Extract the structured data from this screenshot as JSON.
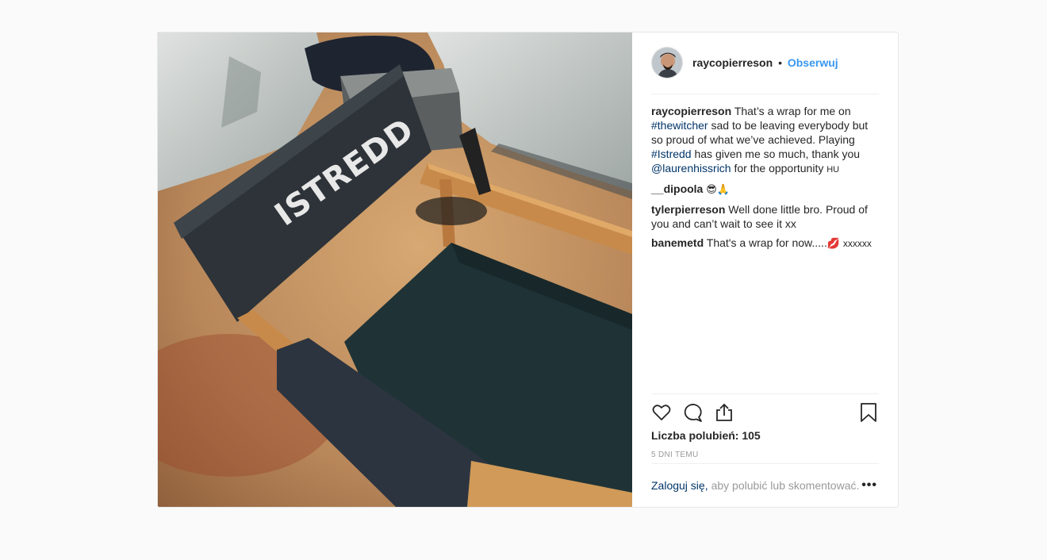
{
  "header": {
    "username": "raycopierreson",
    "separator": "•",
    "follow_label": "Obserwuj"
  },
  "photo": {
    "chair_back_text": "ISTREDD"
  },
  "caption": {
    "username": "raycopierreson",
    "text_1": "That’s a wrap for me on",
    "tag_1": "#thewitcher",
    "text_2": "sad to be leaving everybody but so proud of what we’ve achieved. Playing",
    "tag_2": "#Istredd",
    "text_3": "has given me so much, thank you",
    "tag_3": "@laurenhissrich",
    "text_4": "for the opportunity",
    "text_5": "HU"
  },
  "comments": [
    {
      "username": "__dipoola",
      "text": "😎🙏"
    },
    {
      "username": "tylerpierreson",
      "text": "Well done little bro. Proud of you and can’t wait to see it xx"
    },
    {
      "username": "banemetd",
      "text": "That's a wrap for now.....",
      "emoji": "💋",
      "tail": "xxxxxx"
    }
  ],
  "actions": {
    "icons": [
      "heart-icon",
      "comment-icon",
      "share-icon",
      "bookmark-icon"
    ],
    "likes_text": "Liczba polubień: 105",
    "time_text": "5 DNI TEMU"
  },
  "login": {
    "link_text": "Zaloguj się,",
    "rest_text": "aby polubić lub skomentować.",
    "more_label": "•••"
  },
  "colors": {
    "accent": "#3897f0",
    "link": "#003569",
    "muted": "#999999",
    "border": "#efefef"
  }
}
